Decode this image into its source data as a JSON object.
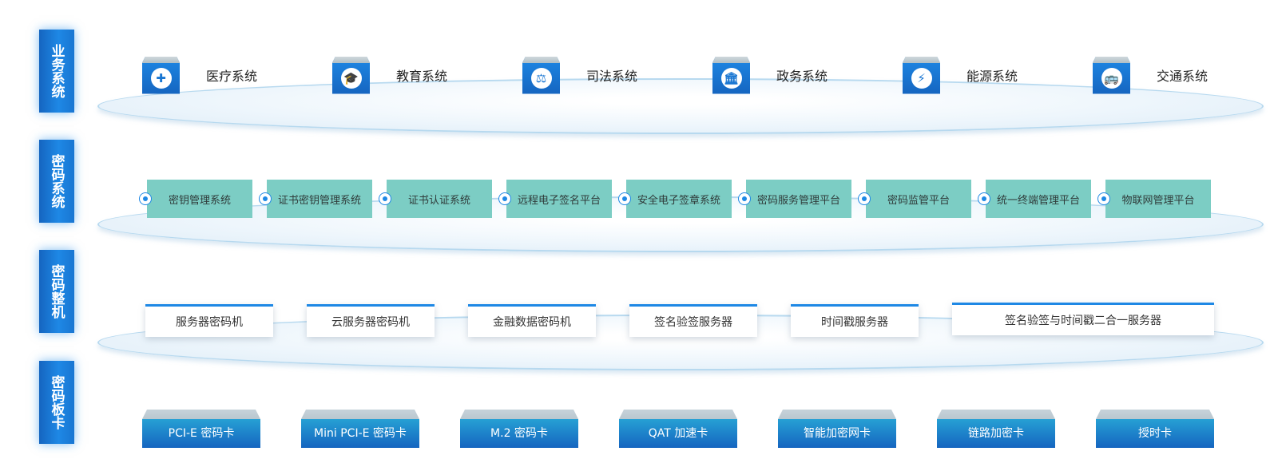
{
  "layers": {
    "business": "业务系统",
    "crypto_system": "密码系统",
    "crypto_machine": "密码整机",
    "crypto_card": "密码板卡"
  },
  "business_systems": [
    {
      "label": "医疗系统",
      "icon": "medical-kit-icon",
      "glyph": "✚"
    },
    {
      "label": "教育系统",
      "icon": "graduation-cap-icon",
      "glyph": "🎓"
    },
    {
      "label": "司法系统",
      "icon": "scales-icon",
      "glyph": "⚖"
    },
    {
      "label": "政务系统",
      "icon": "government-building-icon",
      "glyph": "🏛"
    },
    {
      "label": "能源系统",
      "icon": "energy-drop-icon",
      "glyph": "⚡"
    },
    {
      "label": "交通系统",
      "icon": "bus-icon",
      "glyph": "🚌"
    }
  ],
  "crypto_systems": [
    "密钥管理系统",
    "证书密钥管理系统",
    "证书认证系统",
    "远程电子签名平台",
    "安全电子签章系统",
    "密码服务管理平台",
    "密码监管平台",
    "统一终端管理平台",
    "物联网管理平台"
  ],
  "crypto_machines": [
    "服务器密码机",
    "云服务器密码机",
    "金融数据密码机",
    "签名验签服务器",
    "时间戳服务器",
    "签名验签与时间戳二合一服务器"
  ],
  "crypto_cards": [
    "PCI-E 密码卡",
    "Mini PCI-E 密码卡",
    "M.2 密码卡",
    "QAT 加速卡",
    "智能加密网卡",
    "链路加密卡",
    "授时卡"
  ],
  "colors": {
    "primary_blue": "#1e88e5",
    "teal": "#7ccdc4",
    "ellipse_border": "#b7d9ef"
  }
}
